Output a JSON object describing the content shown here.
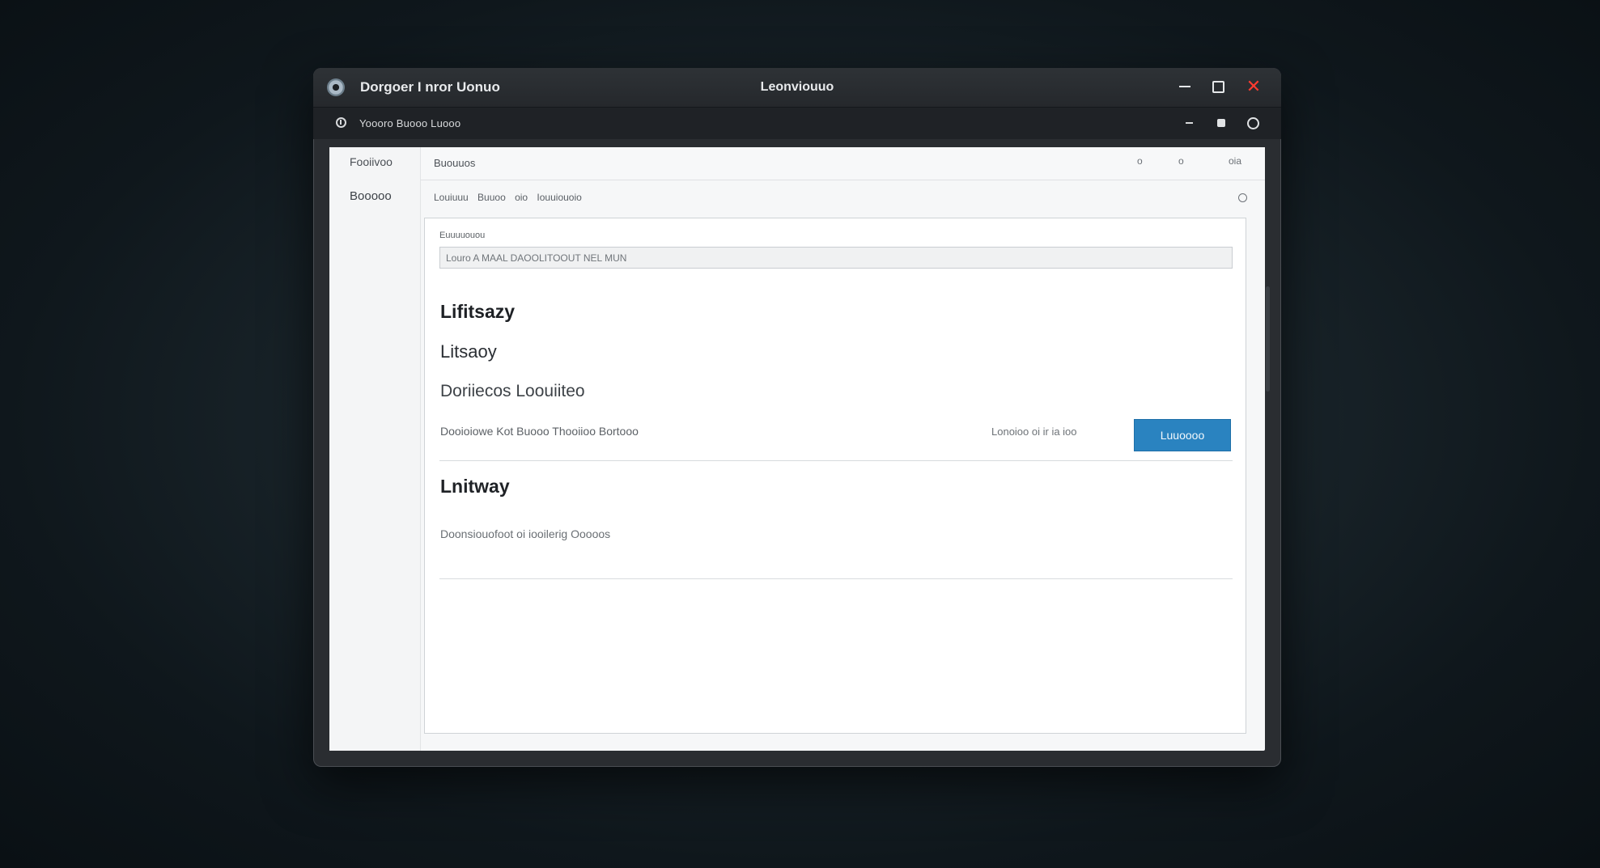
{
  "window": {
    "app_name": "Dorgoer I nror Uonuo",
    "title": "Leonviouuo",
    "controls": {
      "minimize": "–",
      "maximize": "□",
      "close": "✕"
    }
  },
  "toolbar": {
    "path": "Yoooro  Buooo  Luooo"
  },
  "sidebar": {
    "items": [
      {
        "label": "Fooiivoo"
      },
      {
        "label": "Booooo"
      }
    ]
  },
  "header": {
    "label": "Buouuos",
    "controls": [
      "o",
      "o",
      "oia"
    ]
  },
  "breadcrumb": {
    "text": "Louiuuu  Buuoo  oio Iouuiouoio"
  },
  "form": {
    "field_label": "Euuuuouou",
    "field_value": "Louro A MAAL DAOOLITOOUT NEL MUN"
  },
  "content": {
    "title": "Lifitsazy",
    "subtitle": "Litsaoy",
    "section": "Doriiecos Loouiiteo",
    "row_desc": "Dooioiowe Kot Buooo  Thooiioo Bortooo",
    "row_status": "Lonoioo oi ir ia ioo",
    "button_label": "Luuoooo",
    "title2": "Lnitway",
    "row_desc2": "Doonsiouofoot oi iooilerig Ooooos"
  },
  "colors": {
    "accent": "#2a83c0",
    "close_button": "#ff3b30",
    "window_chrome": "#2a2d31"
  }
}
